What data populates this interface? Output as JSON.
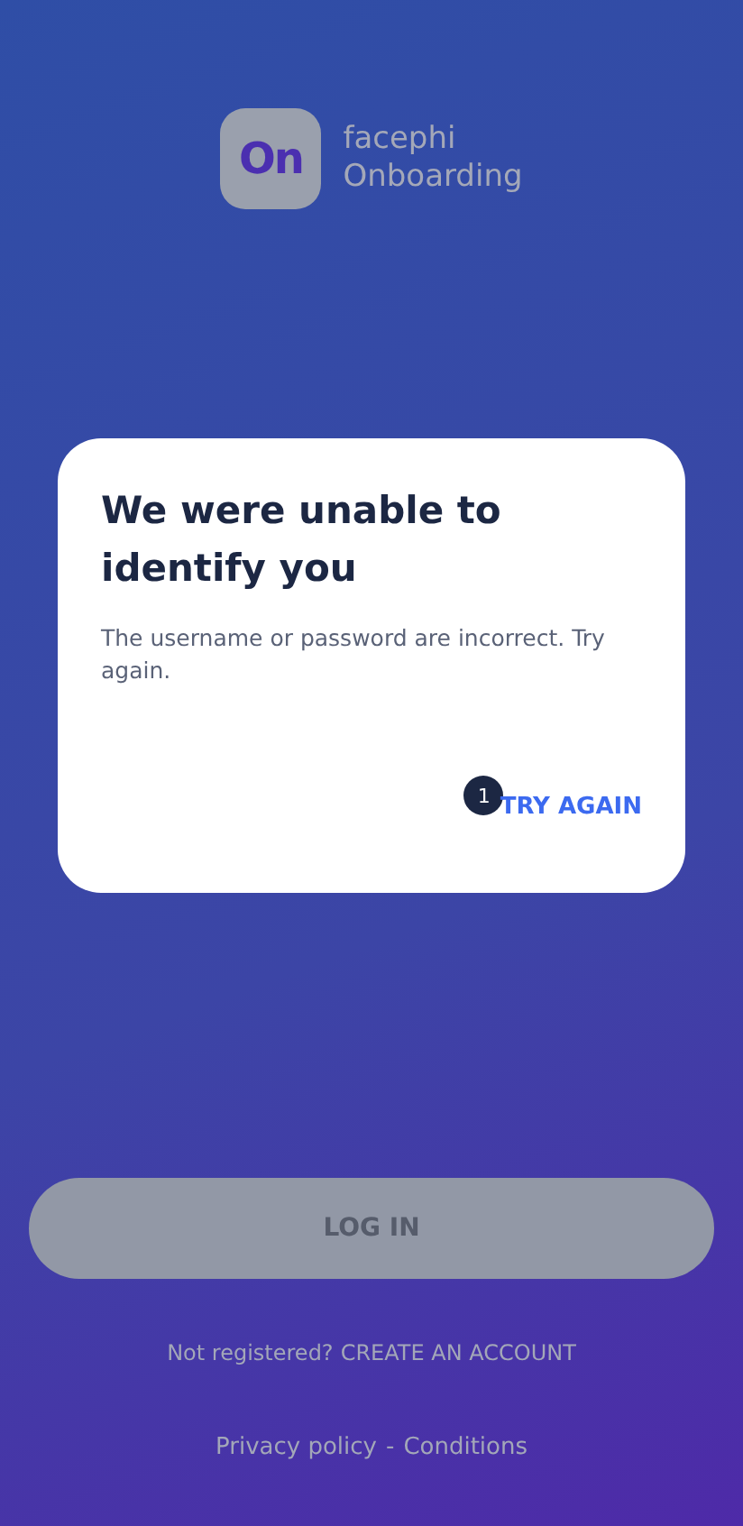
{
  "logo": {
    "mark": "On",
    "brand": "facephi",
    "product": "Onboarding"
  },
  "dialog": {
    "title": "We were unable to identify you",
    "message": "The username or password are incorrect. Try again.",
    "badge": "1",
    "action": "TRY AGAIN"
  },
  "login_button": {
    "label": "LOG IN",
    "disabled": true
  },
  "register": {
    "prompt": "Not registered?",
    "link": "CREATE AN ACCOUNT"
  },
  "footer": {
    "privacy": "Privacy policy",
    "separator": "-",
    "conditions": "Conditions"
  }
}
